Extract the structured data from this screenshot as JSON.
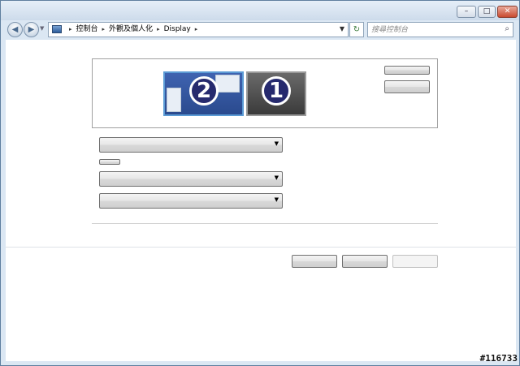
{
  "window": {
    "controls": {
      "minimize_glyph": "–",
      "maximize_glyph": "□",
      "close_glyph": "✕"
    }
  },
  "nav": {
    "back_icon": "back-arrow-icon",
    "forward_icon": "forward-arrow-icon",
    "back_glyph": "◀",
    "forward_glyph": "▶"
  },
  "address": {
    "crumbs": [
      "控制台",
      "外觀及個人化",
      "Display"
    ],
    "separator": "▸",
    "refresh_glyph": "↻"
  },
  "search": {
    "placeholder": "搜尋控制台",
    "icon_glyph": "⌕"
  },
  "monitors": [
    {
      "number": "2",
      "selected": true
    },
    {
      "number": "1",
      "selected": false
    }
  ],
  "watermark": "#116733"
}
